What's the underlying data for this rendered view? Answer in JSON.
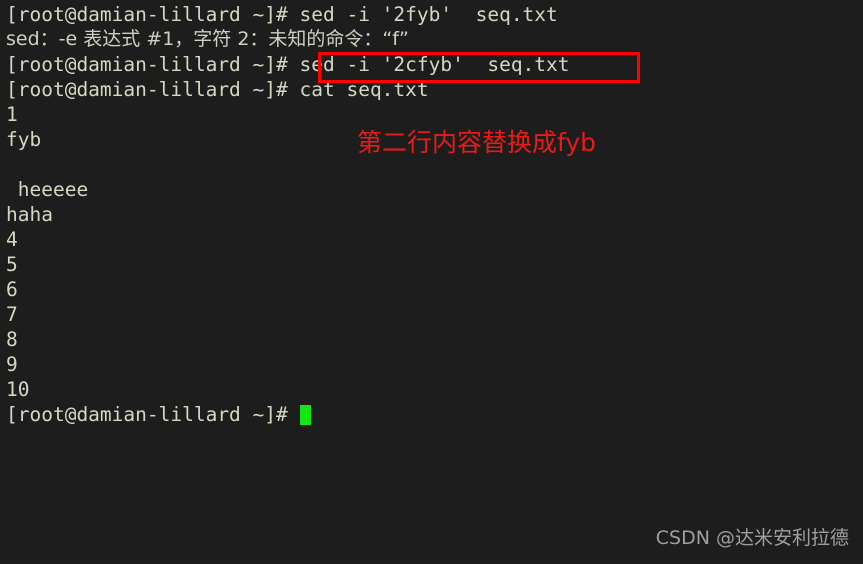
{
  "terminal": {
    "background_color": "#1d1d1d",
    "text_color": "#d6d6c2",
    "cursor_color": "#13e612",
    "lines": [
      {
        "id": "cmd-sed-2fyb",
        "text": "[root@damian-lillard ~]# sed -i '2fyb'  seq.txt",
        "kind": "command"
      },
      {
        "id": "sed-error",
        "text": "sed：-e 表达式 #1，字符 2：未知的命令：“f”",
        "kind": "error"
      },
      {
        "id": "cmd-sed-2cfyb",
        "text": "[root@damian-lillard ~]# sed -i '2cfyb'  seq.txt",
        "kind": "command"
      },
      {
        "id": "cmd-cat-seq",
        "text": "[root@damian-lillard ~]# cat seq.txt",
        "kind": "command"
      },
      {
        "id": "out-1",
        "text": "1",
        "kind": "output"
      },
      {
        "id": "out-fyb",
        "text": "fyb",
        "kind": "output"
      },
      {
        "id": "out-blank",
        "text": "",
        "kind": "output"
      },
      {
        "id": "out-heeeee",
        "text": " heeeee",
        "kind": "output"
      },
      {
        "id": "out-haha",
        "text": "haha",
        "kind": "output"
      },
      {
        "id": "out-4",
        "text": "4",
        "kind": "output"
      },
      {
        "id": "out-5",
        "text": "5",
        "kind": "output"
      },
      {
        "id": "out-6",
        "text": "6",
        "kind": "output"
      },
      {
        "id": "out-7",
        "text": "7",
        "kind": "output"
      },
      {
        "id": "out-8",
        "text": "8",
        "kind": "output"
      },
      {
        "id": "out-9",
        "text": "9",
        "kind": "output"
      },
      {
        "id": "out-10",
        "text": "10",
        "kind": "output"
      }
    ],
    "prompt_line": {
      "prompt": "[root@damian-lillard ~]# ",
      "input_value": "",
      "cursor_visible": true
    }
  },
  "annotations": {
    "highlight_box": {
      "label": "red-rectangle-around-sed-2cfyb-command",
      "color": "#fe0000"
    },
    "note": {
      "text": "第二行内容替换成fyb",
      "color": "#e81b17"
    }
  },
  "watermark": {
    "text": "CSDN @达米安利拉德",
    "color": "#a9a9a9"
  }
}
